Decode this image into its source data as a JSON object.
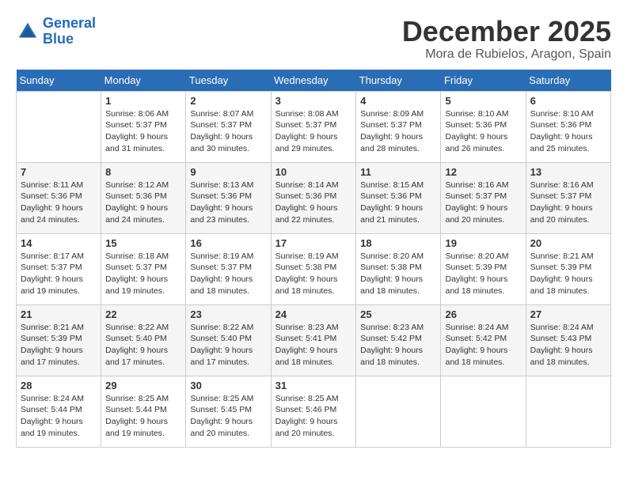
{
  "logo": {
    "line1": "General",
    "line2": "Blue"
  },
  "title": {
    "month": "December 2025",
    "location": "Mora de Rubielos, Aragon, Spain"
  },
  "headers": [
    "Sunday",
    "Monday",
    "Tuesday",
    "Wednesday",
    "Thursday",
    "Friday",
    "Saturday"
  ],
  "weeks": [
    [
      {
        "day": "",
        "info": ""
      },
      {
        "day": "1",
        "info": "Sunrise: 8:06 AM\nSunset: 5:37 PM\nDaylight: 9 hours\nand 31 minutes."
      },
      {
        "day": "2",
        "info": "Sunrise: 8:07 AM\nSunset: 5:37 PM\nDaylight: 9 hours\nand 30 minutes."
      },
      {
        "day": "3",
        "info": "Sunrise: 8:08 AM\nSunset: 5:37 PM\nDaylight: 9 hours\nand 29 minutes."
      },
      {
        "day": "4",
        "info": "Sunrise: 8:09 AM\nSunset: 5:37 PM\nDaylight: 9 hours\nand 28 minutes."
      },
      {
        "day": "5",
        "info": "Sunrise: 8:10 AM\nSunset: 5:36 PM\nDaylight: 9 hours\nand 26 minutes."
      },
      {
        "day": "6",
        "info": "Sunrise: 8:10 AM\nSunset: 5:36 PM\nDaylight: 9 hours\nand 25 minutes."
      }
    ],
    [
      {
        "day": "7",
        "info": "Sunrise: 8:11 AM\nSunset: 5:36 PM\nDaylight: 9 hours\nand 24 minutes."
      },
      {
        "day": "8",
        "info": "Sunrise: 8:12 AM\nSunset: 5:36 PM\nDaylight: 9 hours\nand 24 minutes."
      },
      {
        "day": "9",
        "info": "Sunrise: 8:13 AM\nSunset: 5:36 PM\nDaylight: 9 hours\nand 23 minutes."
      },
      {
        "day": "10",
        "info": "Sunrise: 8:14 AM\nSunset: 5:36 PM\nDaylight: 9 hours\nand 22 minutes."
      },
      {
        "day": "11",
        "info": "Sunrise: 8:15 AM\nSunset: 5:36 PM\nDaylight: 9 hours\nand 21 minutes."
      },
      {
        "day": "12",
        "info": "Sunrise: 8:16 AM\nSunset: 5:37 PM\nDaylight: 9 hours\nand 20 minutes."
      },
      {
        "day": "13",
        "info": "Sunrise: 8:16 AM\nSunset: 5:37 PM\nDaylight: 9 hours\nand 20 minutes."
      }
    ],
    [
      {
        "day": "14",
        "info": "Sunrise: 8:17 AM\nSunset: 5:37 PM\nDaylight: 9 hours\nand 19 minutes."
      },
      {
        "day": "15",
        "info": "Sunrise: 8:18 AM\nSunset: 5:37 PM\nDaylight: 9 hours\nand 19 minutes."
      },
      {
        "day": "16",
        "info": "Sunrise: 8:19 AM\nSunset: 5:37 PM\nDaylight: 9 hours\nand 18 minutes."
      },
      {
        "day": "17",
        "info": "Sunrise: 8:19 AM\nSunset: 5:38 PM\nDaylight: 9 hours\nand 18 minutes."
      },
      {
        "day": "18",
        "info": "Sunrise: 8:20 AM\nSunset: 5:38 PM\nDaylight: 9 hours\nand 18 minutes."
      },
      {
        "day": "19",
        "info": "Sunrise: 8:20 AM\nSunset: 5:39 PM\nDaylight: 9 hours\nand 18 minutes."
      },
      {
        "day": "20",
        "info": "Sunrise: 8:21 AM\nSunset: 5:39 PM\nDaylight: 9 hours\nand 18 minutes."
      }
    ],
    [
      {
        "day": "21",
        "info": "Sunrise: 8:21 AM\nSunset: 5:39 PM\nDaylight: 9 hours\nand 17 minutes."
      },
      {
        "day": "22",
        "info": "Sunrise: 8:22 AM\nSunset: 5:40 PM\nDaylight: 9 hours\nand 17 minutes."
      },
      {
        "day": "23",
        "info": "Sunrise: 8:22 AM\nSunset: 5:40 PM\nDaylight: 9 hours\nand 17 minutes."
      },
      {
        "day": "24",
        "info": "Sunrise: 8:23 AM\nSunset: 5:41 PM\nDaylight: 9 hours\nand 18 minutes."
      },
      {
        "day": "25",
        "info": "Sunrise: 8:23 AM\nSunset: 5:42 PM\nDaylight: 9 hours\nand 18 minutes."
      },
      {
        "day": "26",
        "info": "Sunrise: 8:24 AM\nSunset: 5:42 PM\nDaylight: 9 hours\nand 18 minutes."
      },
      {
        "day": "27",
        "info": "Sunrise: 8:24 AM\nSunset: 5:43 PM\nDaylight: 9 hours\nand 18 minutes."
      }
    ],
    [
      {
        "day": "28",
        "info": "Sunrise: 8:24 AM\nSunset: 5:44 PM\nDaylight: 9 hours\nand 19 minutes."
      },
      {
        "day": "29",
        "info": "Sunrise: 8:25 AM\nSunset: 5:44 PM\nDaylight: 9 hours\nand 19 minutes."
      },
      {
        "day": "30",
        "info": "Sunrise: 8:25 AM\nSunset: 5:45 PM\nDaylight: 9 hours\nand 20 minutes."
      },
      {
        "day": "31",
        "info": "Sunrise: 8:25 AM\nSunset: 5:46 PM\nDaylight: 9 hours\nand 20 minutes."
      },
      {
        "day": "",
        "info": ""
      },
      {
        "day": "",
        "info": ""
      },
      {
        "day": "",
        "info": ""
      }
    ]
  ]
}
